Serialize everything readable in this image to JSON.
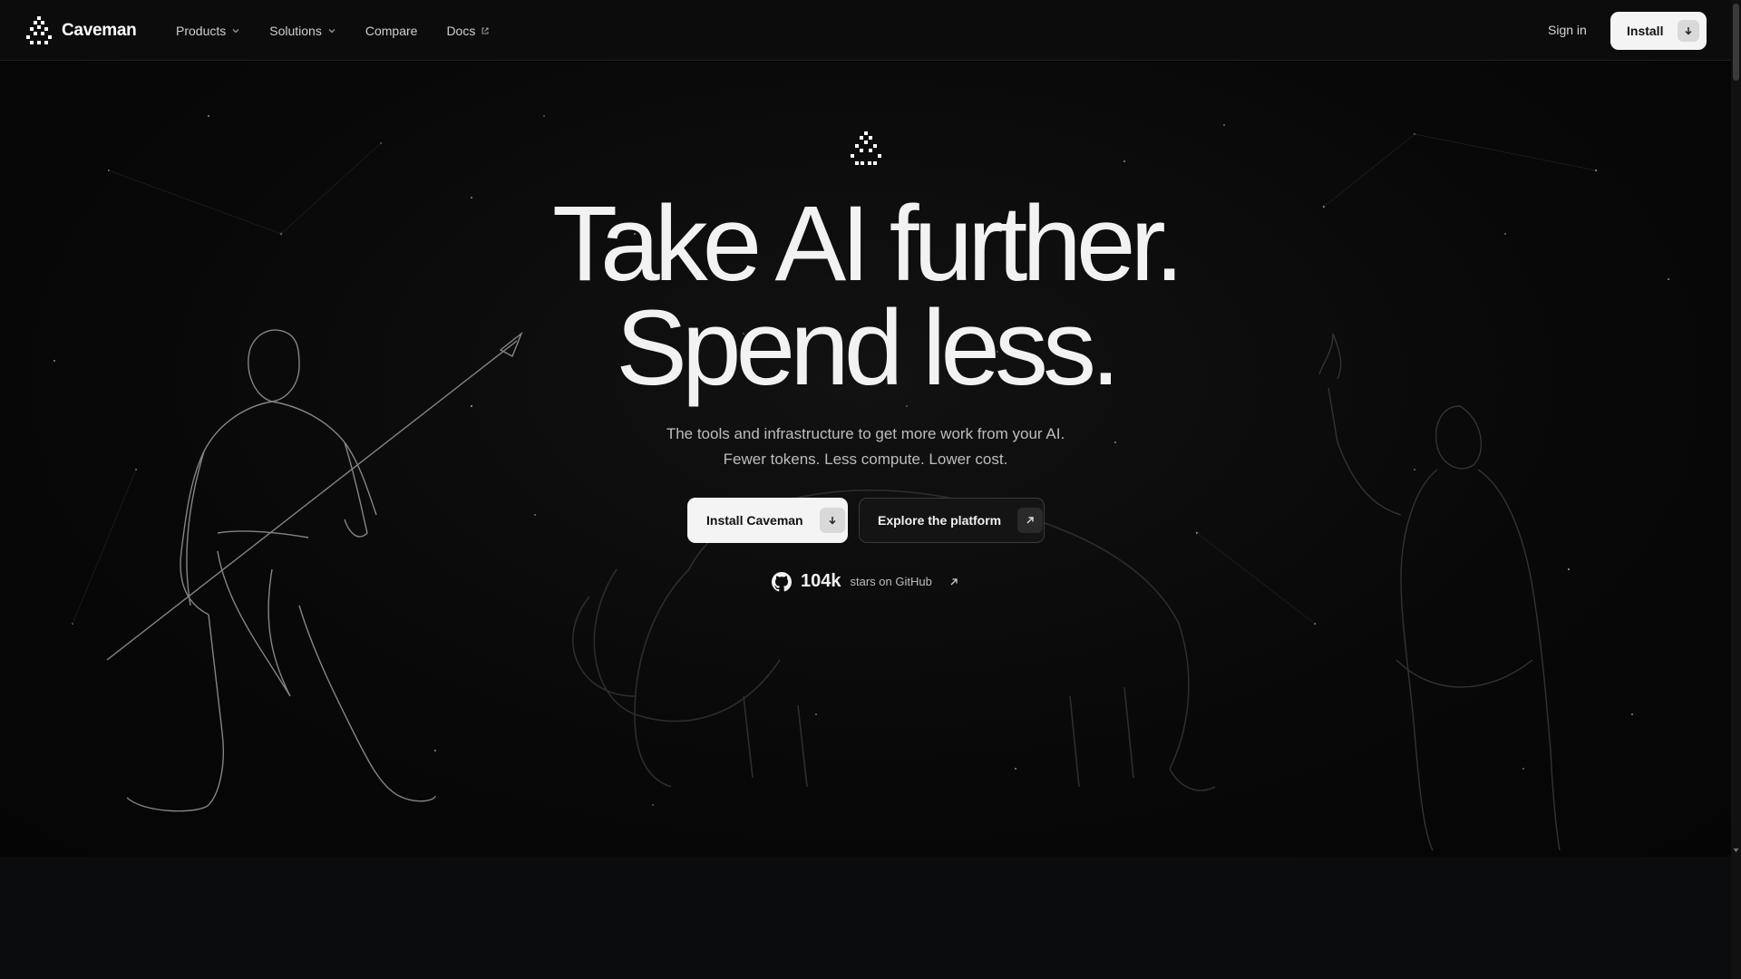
{
  "nav": {
    "brand": "Caveman",
    "items": [
      {
        "label": "Products",
        "icon": "chevron-down-icon"
      },
      {
        "label": "Solutions",
        "icon": "chevron-down-icon"
      },
      {
        "label": "Compare",
        "icon": ""
      },
      {
        "label": "Docs",
        "icon": "external-link-icon"
      }
    ],
    "signin": "Sign in",
    "install": "Install"
  },
  "hero": {
    "headline_1": "Take AI further.",
    "headline_2": "Spend less.",
    "sub_1": "The tools and infrastructure to get more work from your AI.",
    "sub_2": "Fewer tokens. Less compute. Lower cost.",
    "primary_button": "Install Caveman",
    "secondary_button": "Explore the platform",
    "github_count": "104k",
    "github_text": "stars on GitHub"
  },
  "colors": {
    "background": "#000000",
    "nav": "#0c0c0c",
    "button_light": "#f4f4f4",
    "text": "#f2f2f2"
  }
}
